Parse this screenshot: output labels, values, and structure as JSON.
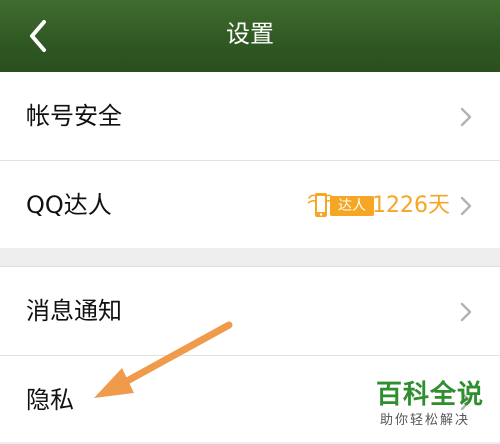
{
  "header": {
    "title": "设置",
    "back_icon": "back-arrow-icon"
  },
  "settings": {
    "group1": [
      {
        "label": "帐号安全",
        "icon": "chevron-right-icon"
      },
      {
        "label": "QQ达人",
        "badge_text": "达人",
        "days_text": "1226天",
        "icon": "chevron-right-icon"
      }
    ],
    "group2": [
      {
        "label": "消息通知",
        "icon": "chevron-right-icon"
      },
      {
        "label": "隐私",
        "icon": "chevron-right-icon"
      }
    ]
  },
  "watermark": {
    "title": "百科全说",
    "subtitle": "助你轻松解决"
  },
  "colors": {
    "header": "#2f5822",
    "accent": "#f5a623",
    "watermark": "#2f8f2f",
    "annotation_arrow": "#f09a4c"
  }
}
